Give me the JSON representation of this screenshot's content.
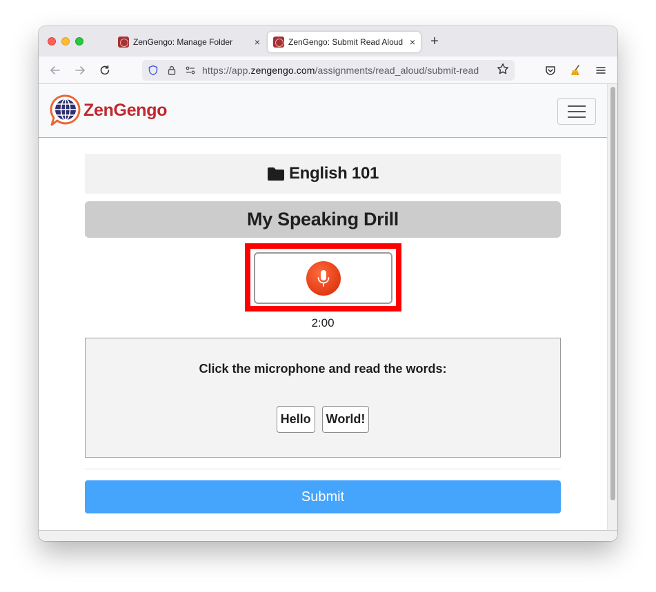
{
  "browser": {
    "tabs": [
      {
        "title": "ZenGengo: Manage Folder",
        "close": "×"
      },
      {
        "title": "ZenGengo: Submit Read Aloud",
        "close": "×"
      }
    ],
    "new_tab": "+",
    "url_prefix": "https://app.",
    "url_host": "zengengo.com",
    "url_path": "/assignments/read_aloud/submit-read",
    "icons": [
      "back-arrow-icon",
      "forward-arrow-icon",
      "reload-icon",
      "shield-icon",
      "lock-icon",
      "permissions-icon",
      "star-icon",
      "pocket-icon",
      "extension-broom-icon",
      "menu-icon"
    ]
  },
  "site": {
    "brand": "ZenGengo",
    "brand_color": "#c0282f",
    "folder": "English 101",
    "assignment_title": "My Speaking Drill",
    "timer": "2:00",
    "instruction": "Click the microphone and read the words:",
    "words": [
      "Hello",
      "World!"
    ],
    "submit_label": "Submit",
    "accent": "#45a4fc",
    "mic_color": "#e23a14",
    "highlight_color": "#ff0000"
  }
}
